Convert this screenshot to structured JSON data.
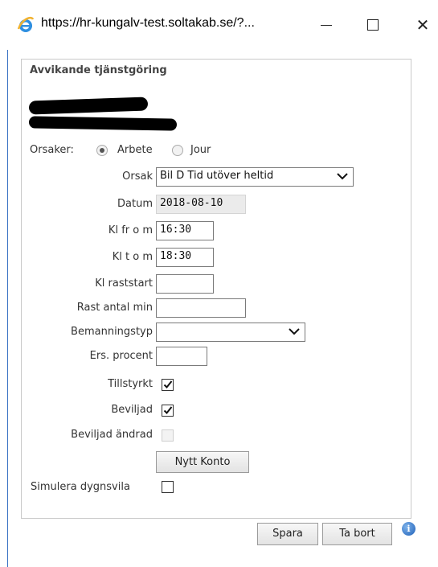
{
  "window": {
    "url": "https://hr-kungalv-test.soltakab.se/?..."
  },
  "dialog": {
    "title": "Avvikande tjänstgöring"
  },
  "orsaker": {
    "label": "Orsaker:",
    "options": [
      "Arbete",
      "Jour"
    ],
    "selected": "Arbete"
  },
  "form": {
    "orsak_label": "Orsak",
    "orsak_value": "Bil D Tid utöver heltid",
    "datum_label": "Datum",
    "datum_value": "2018-08-10",
    "kl_from_label": "Kl fr o m",
    "kl_from_value": "16:30",
    "kl_tom_label": "Kl t o m",
    "kl_tom_value": "18:30",
    "kl_raststart_label": "Kl raststart",
    "kl_raststart_value": "",
    "rast_antal_label": "Rast antal min",
    "rast_antal_value": "",
    "bemanningstyp_label": "Bemanningstyp",
    "bemanningstyp_value": "",
    "ers_procent_label": "Ers. procent",
    "ers_procent_value": "",
    "tillstyrkt_label": "Tillstyrkt",
    "tillstyrkt_checked": true,
    "beviljad_label": "Beviljad",
    "beviljad_checked": true,
    "beviljad_andrad_label": "Beviljad ändrad",
    "beviljad_andrad_checked": false,
    "nytt_konto_label": "Nytt Konto",
    "simulera_label": "Simulera dygnsvila",
    "simulera_checked": false
  },
  "actions": {
    "spara_label": "Spara",
    "ta_bort_label": "Ta bort"
  },
  "colors": {
    "window_border": "#3b73c4",
    "info_icon": "#1d5fb8"
  },
  "icons": {
    "browser": "ie-icon",
    "info": "info-icon"
  }
}
